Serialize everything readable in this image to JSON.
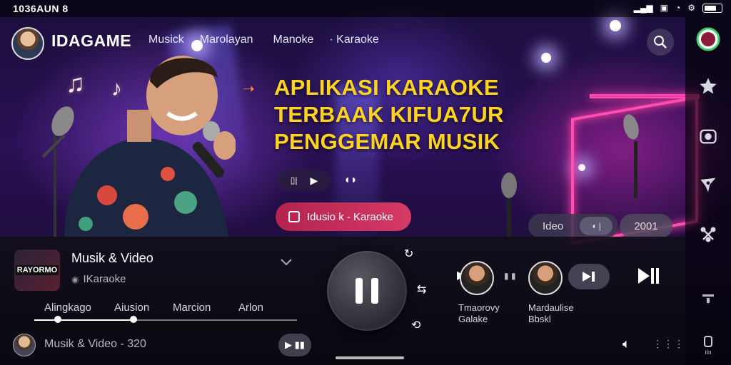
{
  "status_bar": {
    "time": "1036AUN 8"
  },
  "header": {
    "brand": "IDAGAME",
    "nav": [
      "Musick",
      "Marolayan",
      "Manoke",
      "· Karaoke"
    ]
  },
  "hero": {
    "title_lines": [
      "APLIKASI KARAOKE",
      "TERBAAK KIFUA7UR",
      "PENGGEMAR MUSIK"
    ],
    "cta_label": "Idusio k - Karaoke",
    "media_pill_label": "Ideo",
    "year_label": "2001"
  },
  "player": {
    "song_title": "Musik & Video",
    "song_sub": "IKaraoke",
    "album_text": "RAYORMO",
    "tabs": [
      "Alingkago",
      "Aiusion",
      "Marcion",
      "Arlon"
    ],
    "progress": 0.38,
    "now_row_text": "Musik & Video - 320"
  },
  "recommendations": [
    {
      "line1": "Tmaorovy",
      "line2": "Galake"
    },
    {
      "line1": "Mardaulise",
      "line2": "Bbskl"
    }
  ],
  "icons": {
    "search": "search-icon",
    "profile_ring": "profile-ring-icon",
    "star": "star-icon",
    "camera": "camera-icon",
    "guitar": "guitar-icon",
    "share": "share-icon",
    "filter": "filter-icon",
    "library": "library-icon"
  },
  "library_label": "ılıı"
}
